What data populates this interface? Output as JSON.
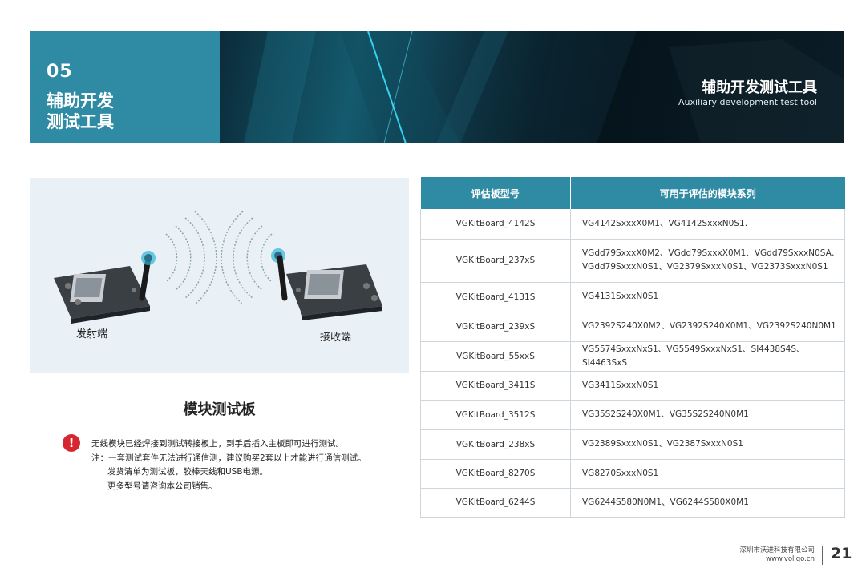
{
  "banner": {
    "number": "05",
    "title_cn_line1": "辅助开发",
    "title_cn_line2": "测试工具",
    "right_title_cn": "辅助开发测试工具",
    "right_title_en": "Auxiliary development test tool"
  },
  "image_panel": {
    "transmitter_label": "发射端",
    "receiver_label": "接收端"
  },
  "module_title": "模块测试板",
  "notes": {
    "line1": "无线模块已经焊接到测试转接板上，到手后插入主板即可进行测试。",
    "line2": "注：一套测试套件无法进行通信测，建议购买2套以上才能进行通信测试。",
    "line3": "发货清单为测试板，胶棒天线和USB电源。",
    "line4": "更多型号请咨询本公司销售。"
  },
  "table": {
    "headers": [
      "评估板型号",
      "可用于评估的模块系列"
    ],
    "rows": [
      {
        "board": "VGKitBoard_4142S",
        "modules": [
          "VG4142SxxxX0M1、VG4142SxxxN0S1."
        ]
      },
      {
        "board": "VGKitBoard_237xS",
        "modules": [
          "VGdd79SxxxX0M2、VGdd79SxxxX0M1、VGdd79SxxxN0SA、",
          "VGdd79SxxxN0S1、VG2379SxxxN0S1、VG2373SxxxN0S1"
        ]
      },
      {
        "board": "VGKitBoard_4131S",
        "modules": [
          "VG4131SxxxN0S1"
        ]
      },
      {
        "board": "VGKitBoard_239xS",
        "modules": [
          "VG2392S240X0M2、VG2392S240X0M1、VG2392S240N0M1"
        ]
      },
      {
        "board": "VGKitBoard_55xxS",
        "modules": [
          "VG5574SxxxNxS1、VG5549SxxxNxS1、SI4438S4S、SI4463SxS"
        ]
      },
      {
        "board": "VGKitBoard_3411S",
        "modules": [
          "VG3411SxxxN0S1"
        ]
      },
      {
        "board": "VGKitBoard_3512S",
        "modules": [
          "VG35S2S240X0M1、VG35S2S240N0M1"
        ]
      },
      {
        "board": "VGKitBoard_238xS",
        "modules": [
          "VG2389SxxxN0S1、VG2387SxxxN0S1"
        ]
      },
      {
        "board": "VGKitBoard_8270S",
        "modules": [
          "VG8270SxxxN0S1"
        ]
      },
      {
        "board": "VGKitBoard_6244S",
        "modules": [
          "VG6244S580N0M1、VG6244S580X0M1"
        ]
      }
    ]
  },
  "footer": {
    "company": "深圳市沃进科技有限公司",
    "website": "www.vollgo.cn",
    "page_number": "21"
  },
  "colors": {
    "accent": "#2f8aa3",
    "panel_bg": "#e9f1f6",
    "warning": "#d6262f"
  },
  "icons": {
    "warning": "exclamation-circle-icon",
    "signal": "wireless-signal-icon"
  }
}
